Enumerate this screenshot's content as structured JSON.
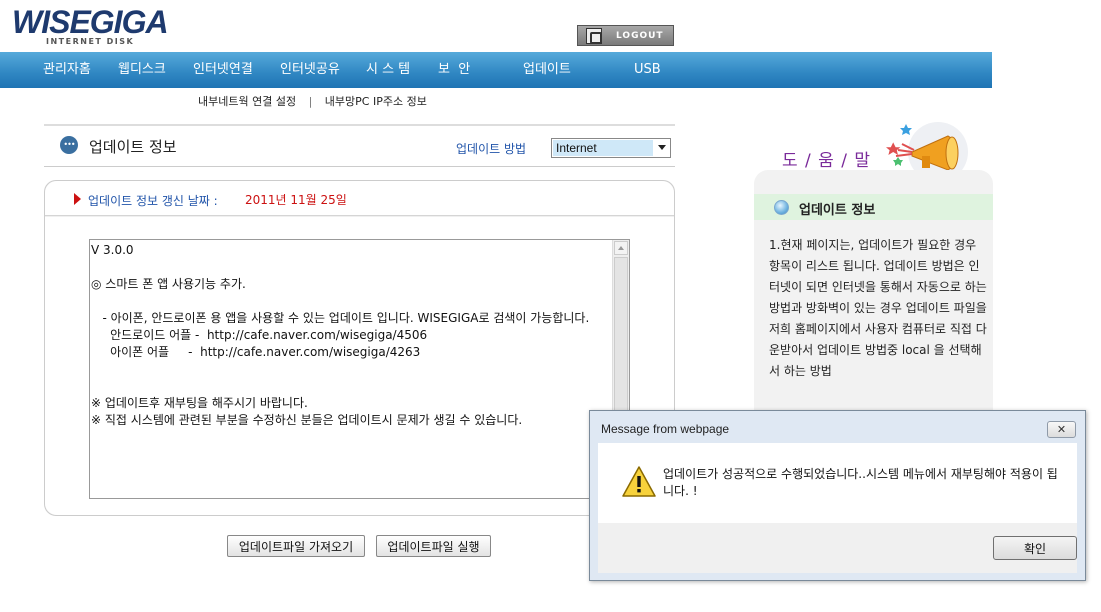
{
  "brand": {
    "name": "WISEGIGA",
    "subtitle": "INTERNET DISK"
  },
  "logout": {
    "label": "LOGOUT"
  },
  "nav": {
    "items": [
      "관리자홈",
      "웹디스크",
      "인터넷연결",
      "인터넷공유",
      "시 스 템",
      "보  안",
      "업데이트",
      "USB"
    ]
  },
  "subnav": {
    "items": [
      "내부네트웍 연결 설정",
      "내부망PC IP주소 정보"
    ],
    "separator": "|"
  },
  "main": {
    "title": "업데이트 정보",
    "method_label": "업데이트 방법",
    "method_value": "Internet",
    "date_label": "업데이트 정보 갱신 날짜 :",
    "date_value": "2011년 11월 25일",
    "notes": "V 3.0.0\n\n◎ 스마트 폰 앱 사용기능 추가.\n\n   - 아이폰, 안드로이폰 용 앱을 사용할 수 있는 업데이트 입니다. WISEGIGA로 검색이 가능합니다.\n     안드로이드 어플 -  http://cafe.naver.com/wisegiga/4506\n     아이폰 어플     -  http://cafe.naver.com/wisegiga/4263\n\n\n※ 업데이트후 재부팅을 해주시기 바랍니다.\n※ 직접 시스템에 관련된 부분을 수정하신 분들은 업데이트시 문제가 생길 수 있습니다.",
    "buttons": {
      "fetch": "업데이트파일 가져오기",
      "run": "업데이트파일 실행"
    }
  },
  "help": {
    "title": "도 / 움 / 말",
    "section_title": "업데이트 정보",
    "text": "1.현재 페이지는, 업데이트가 필요한 경우 항목이 리스트 됩니다. 업데이트 방법은 인터넷이 되면 인터넷을 통해서 자동으로 하는 방법과 방화벽이 있는 경우 업데이트 파일을 저희 홈페이지에서 사용자 컴퓨터로 직접 다운받아서 업데이트 방법중 local 을 선택해서 하는 방법"
  },
  "dialog": {
    "title": "Message from webpage",
    "close": "✕",
    "message": "업데이트가  성공적으로 수행되었습니다..시스템 메뉴에서 재부팅해야 적용이 됩니다. !",
    "ok": "확인"
  },
  "colors": {
    "nav_bar": "#2f86c2",
    "link_blue": "#2255aa",
    "date_red": "#cc1111",
    "help_title": "#7a2a9a",
    "help_header_bg": "#dff3df"
  }
}
